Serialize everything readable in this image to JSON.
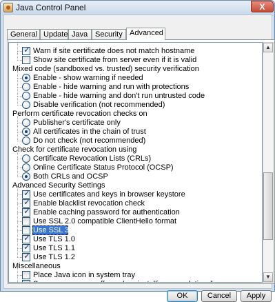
{
  "window": {
    "title": "Java Control Panel",
    "close_glyph": "X"
  },
  "tabs": [
    "General",
    "Update",
    "Java",
    "Security",
    "Advanced"
  ],
  "active_tab": "Advanced",
  "tree": {
    "top_rows": [
      {
        "type": "checkbox",
        "checked": true,
        "label": "Warn if site certificate does not match hostname"
      },
      {
        "type": "checkbox",
        "checked": false,
        "label": "Show site certificate from server even if it is valid"
      }
    ],
    "sections": [
      {
        "title": "Mixed code (sandboxed vs. trusted) security verification",
        "options": [
          {
            "type": "radio",
            "checked": true,
            "label": "Enable - show warning if needed"
          },
          {
            "type": "radio",
            "checked": false,
            "label": "Enable - hide warning and run with protections"
          },
          {
            "type": "radio",
            "checked": false,
            "label": "Enable - hide warning and don't run untrusted code"
          },
          {
            "type": "radio",
            "checked": false,
            "label": "Disable verification (not recommended)"
          }
        ]
      },
      {
        "title": "Perform certificate revocation checks on",
        "options": [
          {
            "type": "radio",
            "checked": false,
            "label": "Publisher's certificate only"
          },
          {
            "type": "radio",
            "checked": true,
            "label": "All certificates in the chain of trust"
          },
          {
            "type": "radio",
            "checked": false,
            "label": "Do not check (not recommended)"
          }
        ]
      },
      {
        "title": "Check for certificate revocation using",
        "options": [
          {
            "type": "radio",
            "checked": false,
            "label": "Certificate Revocation Lists (CRLs)"
          },
          {
            "type": "radio",
            "checked": false,
            "label": "Online Certificate Status Protocol (OCSP)"
          },
          {
            "type": "radio",
            "checked": true,
            "label": "Both CRLs and OCSP"
          }
        ]
      },
      {
        "title": "Advanced Security Settings",
        "options": [
          {
            "type": "checkbox",
            "checked": true,
            "label": "Use certificates and keys in browser keystore"
          },
          {
            "type": "checkbox",
            "checked": true,
            "label": "Enable blacklist revocation check"
          },
          {
            "type": "checkbox",
            "checked": true,
            "label": "Enable caching password for authentication"
          },
          {
            "type": "checkbox",
            "checked": false,
            "label": "Use SSL 2.0 compatible ClientHello format"
          },
          {
            "type": "checkbox",
            "checked": false,
            "label": "Use SSL 3.0",
            "selected": true
          },
          {
            "type": "checkbox",
            "checked": true,
            "label": "Use TLS 1.0"
          },
          {
            "type": "checkbox",
            "checked": true,
            "label": "Use TLS 1.1"
          },
          {
            "type": "checkbox",
            "checked": true,
            "label": "Use TLS 1.2"
          }
        ]
      },
      {
        "title": "Miscellaneous",
        "options": [
          {
            "type": "checkbox",
            "checked": false,
            "label": "Place Java icon in system tray"
          },
          {
            "type": "checkbox",
            "checked": false,
            "label": "Suppress sponsor offers when installing or updating Java"
          }
        ]
      }
    ]
  },
  "scrollbar": {
    "up_glyph": "▲",
    "down_glyph": "▼"
  },
  "buttons": {
    "ok": "OK",
    "cancel": "Cancel",
    "apply": "Apply"
  }
}
